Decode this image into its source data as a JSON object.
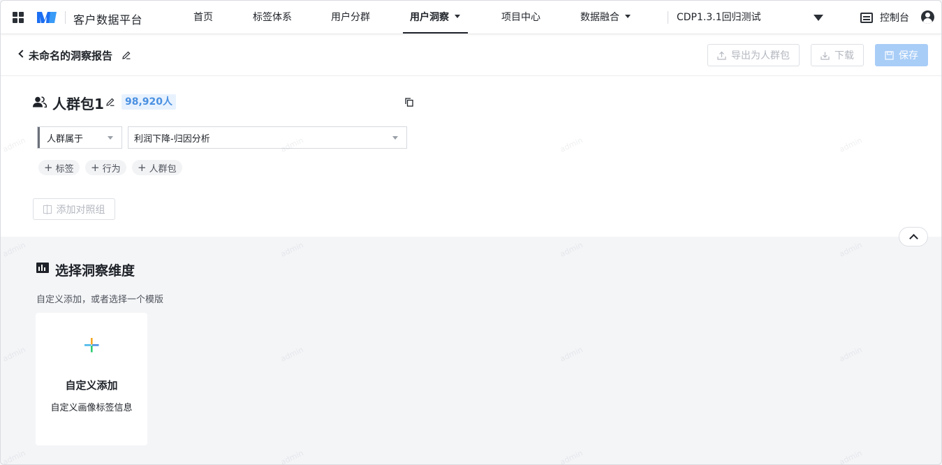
{
  "app": {
    "brand_title": "客户数据平台",
    "logo": "brand-logo",
    "apps_icon": "grid-apps-icon"
  },
  "nav": {
    "items": [
      {
        "label": "首页",
        "active": false,
        "dropdown": false
      },
      {
        "label": "标签体系",
        "active": false,
        "dropdown": false
      },
      {
        "label": "用户分群",
        "active": false,
        "dropdown": false
      },
      {
        "label": "用户洞察",
        "active": true,
        "dropdown": true
      },
      {
        "label": "项目中心",
        "active": false,
        "dropdown": false
      },
      {
        "label": "数据融合",
        "active": false,
        "dropdown": true
      }
    ],
    "project_select": "CDP1.3.1回归测试",
    "console_label": "控制台",
    "user_icon": "user-avatar-icon"
  },
  "report": {
    "title": "未命名的洞察报告",
    "export_label": "导出为人群包",
    "download_label": "下载",
    "save_label": "保存"
  },
  "crowd": {
    "name": "人群包1",
    "count": "98,920人",
    "relation_select": "人群属于",
    "crowd_select": "利润下降-归因分析",
    "add_chips": [
      "标签",
      "行为",
      "人群包"
    ],
    "add_compare_label": "添加对照组"
  },
  "insight": {
    "title": "选择洞察维度",
    "subtitle": "自定义添加，或者选择一个模版",
    "custom_card": {
      "title": "自定义添加",
      "desc": "自定义画像标签信息"
    }
  },
  "watermark_text": "admin",
  "colors": {
    "accent": "#4a90e2",
    "badge_bg": "#e8f2fe",
    "primary_disabled": "#a8cdf7",
    "page_bg": "#f4f5f7"
  }
}
